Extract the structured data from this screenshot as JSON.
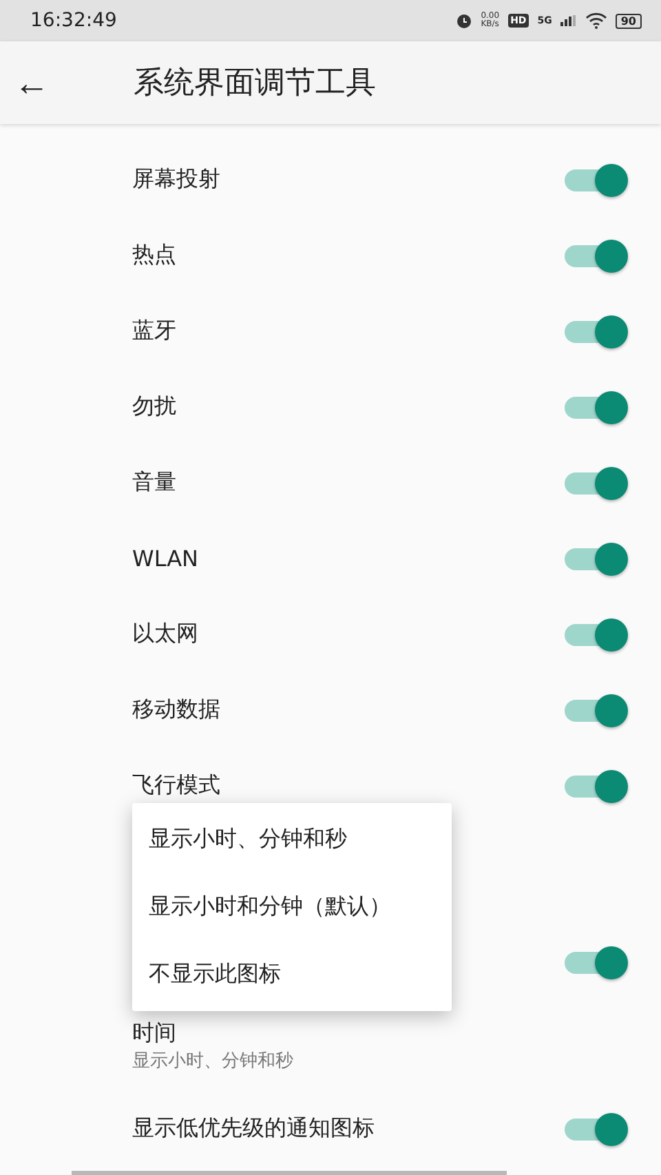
{
  "status_bar": {
    "time": "16:32:49",
    "speed_value": "0.00",
    "speed_unit": "KB/s",
    "hd": "HD",
    "network": "5G",
    "battery": "90"
  },
  "app_bar": {
    "back": "←",
    "title": "系统界面调节工具"
  },
  "settings": [
    {
      "kind": "toggle",
      "label": "屏幕投射",
      "on": true
    },
    {
      "kind": "toggle",
      "label": "热点",
      "on": true
    },
    {
      "kind": "toggle",
      "label": "蓝牙",
      "on": true
    },
    {
      "kind": "toggle",
      "label": "勿扰",
      "on": true
    },
    {
      "kind": "toggle",
      "label": "音量",
      "on": true
    },
    {
      "kind": "toggle",
      "label": "WLAN",
      "on": true
    },
    {
      "kind": "toggle",
      "label": "以太网",
      "on": true
    },
    {
      "kind": "toggle",
      "label": "移动数据",
      "on": true
    },
    {
      "kind": "toggle",
      "label": "飞行模式",
      "on": true
    },
    {
      "kind": "gap"
    },
    {
      "kind": "toggle",
      "on": true
    },
    {
      "kind": "text",
      "label": "时间",
      "summary": "显示小时、分钟和秒"
    },
    {
      "kind": "toggle",
      "label": "显示低优先级的通知图标",
      "on": true
    }
  ],
  "menu": {
    "items": [
      {
        "label": "显示小时、分钟和秒"
      },
      {
        "label": "显示小时和分钟（默认）"
      },
      {
        "label": "不显示此图标"
      }
    ]
  }
}
